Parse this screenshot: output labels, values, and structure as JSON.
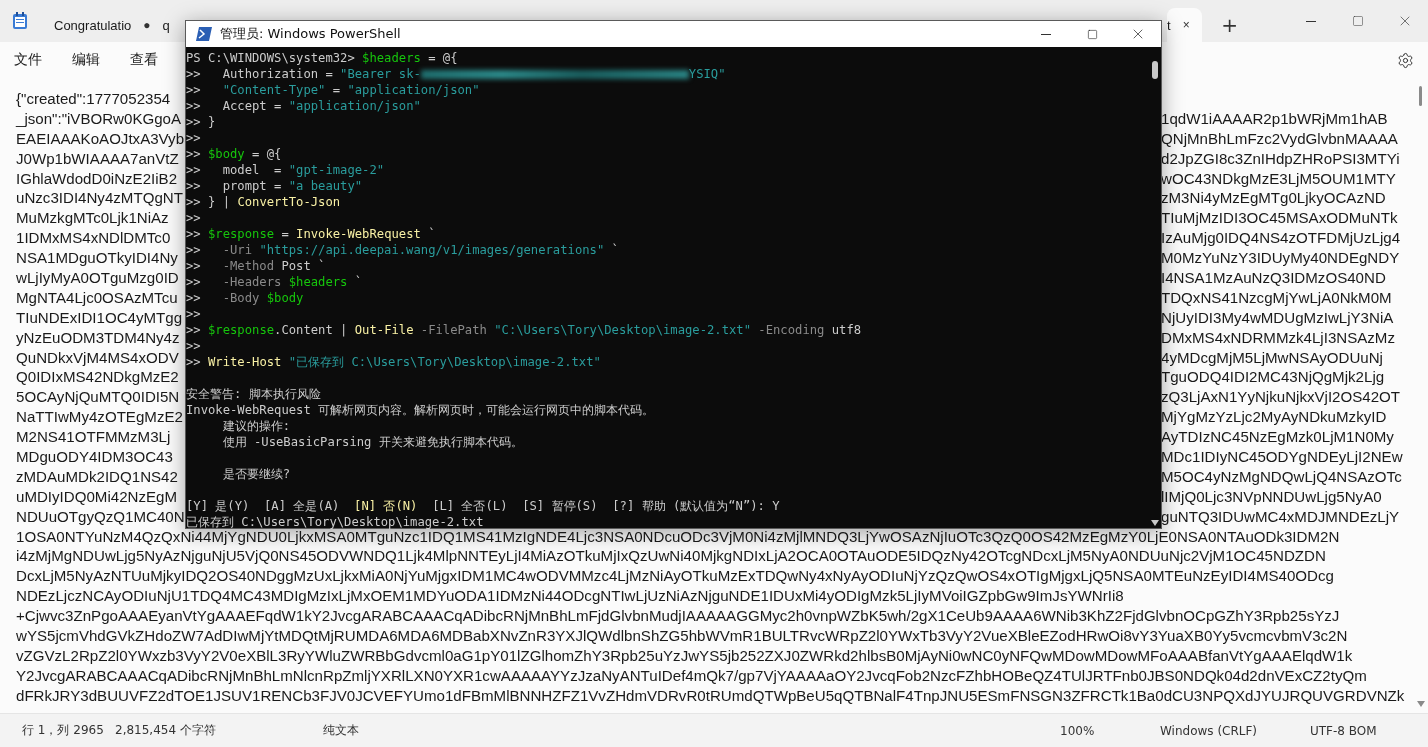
{
  "notepad": {
    "tabs": [
      {
        "label": "Congratulatio",
        "marker": "●",
        "selected": false
      },
      {
        "label": "q",
        "selected": false
      },
      {
        "label": "t",
        "marker": "×",
        "selected": true
      }
    ],
    "new_tab": "+",
    "menu": [
      "文件",
      "编辑",
      "查看"
    ],
    "rows": [
      {
        "kind": "split",
        "left": "{\"created\":1777052354"
      },
      {
        "kind": "split",
        "left": "_json\":\"iVBORw0KGgoA",
        "right": "1qdW1iAAAAR2p1bWRjMm1hAB"
      },
      {
        "kind": "split",
        "left": "EAEIAAAKoAOJtxA3Vyb",
        "right": "QNjMnBhLmFzc2VydGlvbnMAAAA"
      },
      {
        "kind": "split",
        "left": "J0Wp1bWIAAAA7anVtZ",
        "right": "d2JpZGI8c3ZnIHdpZHRoPSI3MTYi"
      },
      {
        "kind": "split",
        "left": "IGhlaWdodD0iNzE2IiB2",
        "right": "wOC43NDkgMzE3LjM5OUM1MTY"
      },
      {
        "kind": "split",
        "left": "uNzc3IDI4Ny4zMTQgNT",
        "right": "zM3Ni4yMzEgMTg0LjkyOCAzND"
      },
      {
        "kind": "split",
        "left": "MuMzkgMTc0Ljk1NiAz",
        "right": "TIuMjMzIDI3OC45MSAxODMuNTk"
      },
      {
        "kind": "split",
        "left": "1IDMxMS4xNDlDMTc0",
        "right": "IzAuMjg0IDQ4NS4zOTFDMjUzLjg4"
      },
      {
        "kind": "split",
        "left": "NSA1MDguOTkyIDI4Ny",
        "right": "M0MzYuNzY3IDUyMy40NDEgNDY"
      },
      {
        "kind": "split",
        "left": "wLjIyMyA0OTguMzg0ID",
        "right": "I4NSA1MzAuNzQ3IDMzOS40ND"
      },
      {
        "kind": "split",
        "left": "MgNTA4Ljc0OSAzMTcu",
        "right": "TDQxNS41NzcgMjYwLjA0NkM0M"
      },
      {
        "kind": "split",
        "left": "TIuNDExIDI1OC4yMTgg",
        "right": "NjUyIDI3My4wMDUgMzIwLjY3NiA"
      },
      {
        "kind": "split",
        "left": "yNzEuODM3TDM4Ny4z",
        "right": "DMxMS4xNDRMMzk4LjI3NSAzMz"
      },
      {
        "kind": "split",
        "left": "QuNDkxVjM4MS4xODV",
        "right": "4yMDcgMjM5LjMwNSAyODUuNj"
      },
      {
        "kind": "split",
        "left": "Q0IDIxMS42NDkgMzE2",
        "right": "TguODQ4IDI2MC43NjQgMjk2Ljg"
      },
      {
        "kind": "split",
        "left": "5OCAyNjQuMTQ0IDI5N",
        "right": "zQ3LjAxN1YyNjkuNjkxVjI2OS42OT"
      },
      {
        "kind": "split",
        "left": "NaTTIwMy4zOTEgMzE2",
        "right": "MjYgMzYzLjc2MyAyNDkuMzkyID"
      },
      {
        "kind": "split",
        "left": "M2NS41OTFMMzM3Lj",
        "right": "AyTDIzNC45NzEgMzk0LjM1N0My"
      },
      {
        "kind": "split",
        "left": "MDguODY4IDM3OC43",
        "right": "MDc1IDIyNC45ODYgNDEyLjI2NEw"
      },
      {
        "kind": "split",
        "left": "zMDAuMDk2IDQ1NS42",
        "right": "M5OC4yNzMgNDQwLjQ4NSAzOTc"
      },
      {
        "kind": "split",
        "left": "uMDIyIDQ0Mi42NzEgM",
        "right": "lIMjQ0Ljc3NVpNNDUwLjg5NyA0"
      },
      {
        "kind": "split",
        "left": "NDUuOTgyQzQ1MC40N",
        "right": "guNTQ3IDUwMC4xMDJMNDEzLjY"
      },
      {
        "kind": "full",
        "text": "1OSA0NTYuNzM4QzQxNi44MjYgNDU0LjkxMSA0MTguNzc1IDQ1MS41MzIgNDE4Ljc3NSA0NDcuODc3VjM0Ni4zMjlMNDQ3LjYwOSAzNjIuOTc3QzQ0OS42MzEgMzY0LjE0NSA0NTAuODk3IDM2N"
      },
      {
        "kind": "full",
        "text": "i4zMjMgNDUwLjg5NyAzNjguNjU5VjQ0NS45ODVWNDQ1Ljk4MlpNNTEyLjI4MiAzOTkuMjIxQzUwNi40MjkgNDIxLjA2OCA0OTAuODE5IDQzNy42OTcgNDcxLjM5NyA0NDUuNjc2VjM1OC45NDZDN"
      },
      {
        "kind": "full",
        "text": "DcxLjM5NyAzNTUuMjkyIDQ2OS40NDggMzUxLjkxMiA0NjYuMjgxIDM1MC4wODVMMzc4LjMzNiAyOTkuMzExTDQwNy4xNyAyODIuNjYzQzQwOS4xOTIgMjgxLjQ5NSA0MTEuNzEyIDI4MS40ODcg"
      },
      {
        "kind": "full",
        "text": "NDEzLjczNCAyODIuNjU1TDQ4MC43MDIgMzIxLjMxOEM1MDYuODA1IDMzNi44ODcgNTIwLjUzNiAzNjguNDE1IDUxMi4yODIgMzk5LjIyMVoiIGZpbGw9ImJsYWNrIi8"
      },
      {
        "kind": "full",
        "text": "+Cjwvc3ZnPgoAAAEyanVtYgAAAEFqdW1kY2JvcgARABCAAACqADibcRNjMnBhLmFjdGlvbnMudjIAAAAAGGMyc2h0vnpWZbK5wh/2gX1CeUb9AAAA6WNib3KhZ2FjdGlvbnOCpGZhY3Rpb25sYzJ"
      },
      {
        "kind": "full",
        "text": "wYS5jcmVhdGVkZHdoZW7AdDIwMjYtMDQtMjRUMDA6MDA6MDBabXNvZnR3YXJlQWdlbnShZG5hbWVmR1BULTRvcWRpZ2l0YWxTb3VyY2VueXBleEZodHRwOi8vY3YuaXB0Yy5vcmcvbmV3c2N"
      },
      {
        "kind": "full",
        "text": "vZGVzL2RpZ2l0YWxzb3VyY2V0eXBlL3RyYWluZWRBbGdvcml0aG1pY01lZGlhomZhY3Rpb25uYzJwYS5jb252ZXJ0ZWRkd2hlbsB0MjAyNi0wNC0yNFQwMDowMDowMFoAAABfanVtYgAAAElqdW1k"
      },
      {
        "kind": "full",
        "text": "Y2JvcgARABCAAACqADibcRNjMnBhLmNlcnRpZmljYXRlLXN0YXR1cwAAAAAYYzJzaNyANTuIDef4mQk7/gp7VjYAAAAaOY2JvcqFob2NzcFZhbHOBeQZ4TUlJRTFnb0JBS0NDQk04d2dnVExCZ2tyQm"
      },
      {
        "kind": "full",
        "text": "dFRkJRY3dBUUVFZ2dTOE1JSUV1RENCb3FJV0JCVEFYUmo1dFBmMlBNNHZFZ1VvZHdmVDRvR0tRUmdQTWpBeU5qQTBNalF4TnpJNU5ESmFNSGN3ZFRCTk1Ba0dCU3NPQXdJYUJRQUVGRDVNZk"
      }
    ],
    "status_bar": [
      "行 1，列 2965",
      "2,815,454 个字符",
      "纯文本",
      "100%",
      "Windows (CRLF)",
      "UTF-8 BOM"
    ]
  },
  "powershell": {
    "title": "管理员: Windows PowerShell",
    "lines": [
      {
        "kind": "code",
        "segments": [
          {
            "kind": "plain",
            "text": "PS C:\\WINDOWS\\system32> "
          },
          {
            "kind": "variable",
            "text": "$headers"
          },
          {
            "kind": "plain",
            "text": " = @{"
          }
        ]
      },
      {
        "kind": "code",
        "segments": [
          {
            "kind": "plain",
            "text": ">>   Authorization = "
          },
          {
            "kind": "string",
            "text": "\"Bearer sk-"
          },
          {
            "kind": "redacted"
          },
          {
            "kind": "string",
            "text": "YSIQ\""
          }
        ]
      },
      {
        "kind": "code",
        "segments": [
          {
            "kind": "plain",
            "text": ">>   "
          },
          {
            "kind": "string",
            "text": "\"Content-Type\""
          },
          {
            "kind": "plain",
            "text": " = "
          },
          {
            "kind": "string",
            "text": "\"application/json\""
          }
        ]
      },
      {
        "kind": "code",
        "segments": [
          {
            "kind": "plain",
            "text": ">>   Accept = "
          },
          {
            "kind": "string",
            "text": "\"application/json\""
          }
        ]
      },
      {
        "kind": "code",
        "segments": [
          {
            "kind": "plain",
            "text": ">> }"
          }
        ]
      },
      {
        "kind": "code",
        "segments": [
          {
            "kind": "plain",
            "text": ">>"
          }
        ]
      },
      {
        "kind": "code",
        "segments": [
          {
            "kind": "plain",
            "text": ">> "
          },
          {
            "kind": "variable",
            "text": "$body"
          },
          {
            "kind": "plain",
            "text": " = @{"
          }
        ]
      },
      {
        "kind": "code",
        "segments": [
          {
            "kind": "plain",
            "text": ">>   model  = "
          },
          {
            "kind": "string",
            "text": "\"gpt-image-2\""
          }
        ]
      },
      {
        "kind": "code",
        "segments": [
          {
            "kind": "plain",
            "text": ">>   prompt = "
          },
          {
            "kind": "string",
            "text": "\"a beauty\""
          }
        ]
      },
      {
        "kind": "code",
        "segments": [
          {
            "kind": "plain",
            "text": ">> } | "
          },
          {
            "kind": "command",
            "text": "ConvertTo-Json"
          }
        ]
      },
      {
        "kind": "code",
        "segments": [
          {
            "kind": "plain",
            "text": ">>"
          }
        ]
      },
      {
        "kind": "code",
        "segments": [
          {
            "kind": "plain",
            "text": ">> "
          },
          {
            "kind": "variable",
            "text": "$response"
          },
          {
            "kind": "plain",
            "text": " = "
          },
          {
            "kind": "command",
            "text": "Invoke-WebRequest"
          },
          {
            "kind": "plain",
            "text": " `"
          }
        ]
      },
      {
        "kind": "code",
        "segments": [
          {
            "kind": "plain",
            "text": ">>   "
          },
          {
            "kind": "parameter",
            "text": "-Uri "
          },
          {
            "kind": "string",
            "text": "\"https://api.deepai.wang/v1/images/generations\""
          },
          {
            "kind": "plain",
            "text": " `"
          }
        ]
      },
      {
        "kind": "code",
        "segments": [
          {
            "kind": "plain",
            "text": ">>   "
          },
          {
            "kind": "parameter",
            "text": "-Method"
          },
          {
            "kind": "plain",
            "text": " Post `"
          }
        ]
      },
      {
        "kind": "code",
        "segments": [
          {
            "kind": "plain",
            "text": ">>   "
          },
          {
            "kind": "parameter",
            "text": "-Headers "
          },
          {
            "kind": "variable",
            "text": "$headers"
          },
          {
            "kind": "plain",
            "text": " `"
          }
        ]
      },
      {
        "kind": "code",
        "segments": [
          {
            "kind": "plain",
            "text": ">>   "
          },
          {
            "kind": "parameter",
            "text": "-Body "
          },
          {
            "kind": "variable",
            "text": "$body"
          }
        ]
      },
      {
        "kind": "code",
        "segments": [
          {
            "kind": "plain",
            "text": ">>"
          }
        ]
      },
      {
        "kind": "code",
        "segments": [
          {
            "kind": "plain",
            "text": ">> "
          },
          {
            "kind": "variable",
            "text": "$response"
          },
          {
            "kind": "plain",
            "text": ".Content | "
          },
          {
            "kind": "command",
            "text": "Out-File"
          },
          {
            "kind": "parameter",
            "text": " -FilePath "
          },
          {
            "kind": "string",
            "text": "\"C:\\Users\\Tory\\Desktop\\image-2.txt\""
          },
          {
            "kind": "parameter",
            "text": " -Encoding"
          },
          {
            "kind": "plain",
            "text": " utf8"
          }
        ]
      },
      {
        "kind": "code",
        "segments": [
          {
            "kind": "plain",
            "text": ">>"
          }
        ]
      },
      {
        "kind": "code",
        "segments": [
          {
            "kind": "plain",
            "text": ">> "
          },
          {
            "kind": "command",
            "text": "Write-Host"
          },
          {
            "kind": "string",
            "text": " \"已保存到 C:\\Users\\Tory\\Desktop\\image-2.txt\""
          }
        ]
      },
      {
        "kind": "blank"
      },
      {
        "kind": "code",
        "segments": [
          {
            "kind": "plain",
            "text": "安全警告: 脚本执行风险"
          }
        ]
      },
      {
        "kind": "code",
        "segments": [
          {
            "kind": "plain",
            "text": "Invoke-WebRequest 可解析网页内容。解析网页时，可能会运行网页中的脚本代码。"
          }
        ]
      },
      {
        "kind": "code",
        "segments": [
          {
            "kind": "plain",
            "text": "     建议的操作:"
          }
        ]
      },
      {
        "kind": "code",
        "segments": [
          {
            "kind": "plain",
            "text": "     使用 -UseBasicParsing 开关来避免执行脚本代码。"
          }
        ]
      },
      {
        "kind": "blank"
      },
      {
        "kind": "code",
        "segments": [
          {
            "kind": "plain",
            "text": "     是否要继续?"
          }
        ]
      },
      {
        "kind": "blank"
      },
      {
        "kind": "code",
        "segments": [
          {
            "kind": "plain",
            "text": "[Y] 是(Y)  [A] 全是(A)  "
          },
          {
            "kind": "command",
            "text": "[N] 否(N)"
          },
          {
            "kind": "plain",
            "text": "  [L] 全否(L)  [S] 暂停(S)  [?] 帮助 (默认值为“N”): Y"
          }
        ]
      },
      {
        "kind": "code",
        "segments": [
          {
            "kind": "plain",
            "text": "已保存到 C:\\Users\\Tory\\Desktop\\image-2.txt"
          }
        ]
      }
    ]
  }
}
